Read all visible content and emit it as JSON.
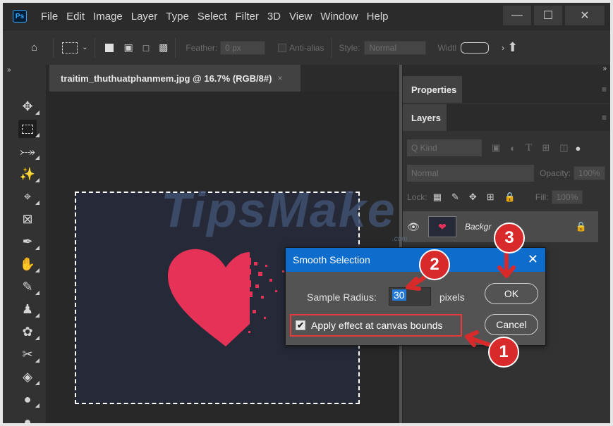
{
  "menubar": {
    "logo": "Ps",
    "items": [
      "File",
      "Edit",
      "Image",
      "Layer",
      "Type",
      "Select",
      "Filter",
      "3D",
      "View",
      "Window",
      "Help"
    ],
    "window_buttons": [
      "—",
      "☐",
      "✕"
    ]
  },
  "options": {
    "feather_label": "Feather:",
    "feather_value": "0 px",
    "antialias_label": "Anti-alias",
    "style_label": "Style:",
    "style_value": "Normal",
    "width_label": "Widtl"
  },
  "document": {
    "tab_title": "traitim_thuthuatphanmem.jpg @ 16.7% (RGB/8#)",
    "tab_close": "×",
    "watermark": "TipsMake",
    "watermark_suffix": ".com"
  },
  "panels": {
    "properties_tab": "Properties",
    "layers_tab": "Layers",
    "kind_label": "Q Kind",
    "blend_mode": "Normal",
    "opacity_label": "Opacity:",
    "opacity_value": "100%",
    "lock_label": "Lock:",
    "fill_label": "Fill:",
    "fill_value": "100%",
    "layer_name": "Backgr"
  },
  "dialog": {
    "title": "Smooth Selection",
    "close": "✕",
    "sample_radius_label": "Sample Radius:",
    "sample_radius_value": "30",
    "unit": "pixels",
    "apply_label": "Apply effect at canvas bounds",
    "apply_checked": true,
    "ok_label": "OK",
    "cancel_label": "Cancel"
  },
  "annotations": {
    "marker_1": "1",
    "marker_2": "2",
    "marker_3": "3"
  },
  "colors": {
    "accent_blue": "#0e6dcc",
    "heart": "#e63256",
    "annotation_red": "#d82a2a"
  }
}
